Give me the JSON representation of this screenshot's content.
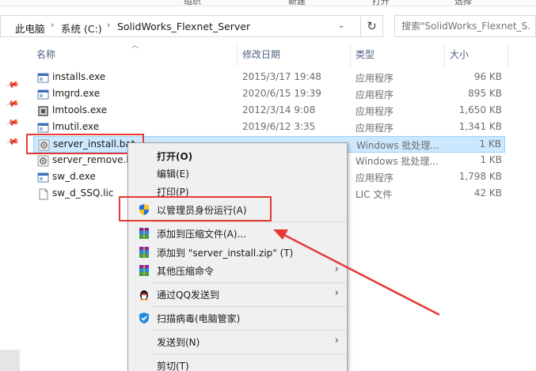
{
  "ribbon": {
    "items": [
      "组织",
      "新建",
      "打开",
      "选择"
    ]
  },
  "breadcrumb": [
    "此电脑",
    "系统 (C:)",
    "SolidWorks_Flexnet_Server"
  ],
  "search": {
    "placeholder": "搜索\"SolidWorks_Flexnet_S..."
  },
  "columns": {
    "name": "名称",
    "date": "修改日期",
    "type": "类型",
    "size": "大小"
  },
  "files": [
    {
      "name": "installs.exe",
      "date": "2015/3/17 19:48",
      "type": "应用程序",
      "size": "96 KB",
      "icon": "exe-icon"
    },
    {
      "name": "lmgrd.exe",
      "date": "2020/6/15 19:39",
      "type": "应用程序",
      "size": "895 KB",
      "icon": "exe-icon"
    },
    {
      "name": "lmtools.exe",
      "date": "2012/3/14 9:08",
      "type": "应用程序",
      "size": "1,650 KB",
      "icon": "tool-icon"
    },
    {
      "name": "lmutil.exe",
      "date": "2019/6/12 3:35",
      "type": "应用程序",
      "size": "1,341 KB",
      "icon": "exe-icon"
    },
    {
      "name": "server_install.bat",
      "date": "",
      "type": "Windows 批处理...",
      "size": "1 KB",
      "icon": "bat-icon"
    },
    {
      "name": "server_remove.b",
      "date": "",
      "type": "Windows 批处理...",
      "size": "1 KB",
      "icon": "bat-icon"
    },
    {
      "name": "sw_d.exe",
      "date": "",
      "type": "应用程序",
      "size": "1,798 KB",
      "icon": "exe-icon"
    },
    {
      "name": "sw_d_SSQ.lic",
      "date": "",
      "type": "LIC 文件",
      "size": "42 KB",
      "icon": "file-icon"
    }
  ],
  "menu": {
    "open": "打开(O)",
    "edit": "编辑(E)",
    "print": "打印(P)",
    "run_as_admin": "以管理员身份运行(A)",
    "add_archive": "添加到压缩文件(A)...",
    "add_zip": "添加到 \"server_install.zip\" (T)",
    "other_compress": "其他压缩命令",
    "send_qq": "通过QQ发送到",
    "scan": "扫描病毒(电脑管家)",
    "send_to": "发送到(N)",
    "cut": "剪切(T)"
  },
  "colors": {
    "selection": "#cce8ff",
    "highlight": "#e53935",
    "menu_bg": "#f0f0f0"
  }
}
